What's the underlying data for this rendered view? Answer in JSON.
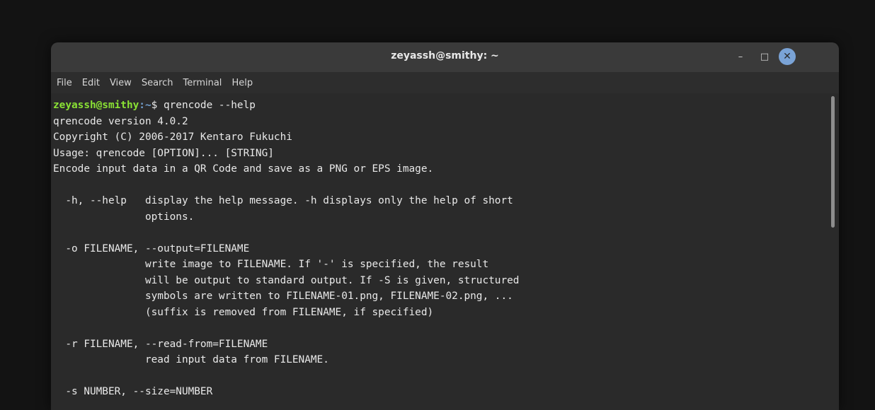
{
  "window": {
    "title": "zeyassh@smithy: ~",
    "controls": {
      "minimize": "–",
      "maximize": "□",
      "close": "✕"
    }
  },
  "menu": [
    "File",
    "Edit",
    "View",
    "Search",
    "Terminal",
    "Help"
  ],
  "terminal": {
    "prompt_user": "zeyassh@smithy",
    "prompt_path": ":~",
    "prompt_symbol": "$ ",
    "command": "qrencode --help",
    "output": [
      "qrencode version 4.0.2",
      "Copyright (C) 2006-2017 Kentaro Fukuchi",
      "Usage: qrencode [OPTION]... [STRING]",
      "Encode input data in a QR Code and save as a PNG or EPS image.",
      "",
      "  -h, --help   display the help message. -h displays only the help of short",
      "               options.",
      "",
      "  -o FILENAME, --output=FILENAME",
      "               write image to FILENAME. If '-' is specified, the result",
      "               will be output to standard output. If -S is given, structured",
      "               symbols are written to FILENAME-01.png, FILENAME-02.png, ...",
      "               (suffix is removed from FILENAME, if specified)",
      "",
      "  -r FILENAME, --read-from=FILENAME",
      "               read input data from FILENAME.",
      "",
      "  -s NUMBER, --size=NUMBER"
    ]
  },
  "colors": {
    "prompt_user": "#8ae234",
    "prompt_path": "#729fcf",
    "text": "#e9e9e9",
    "background": "#2a2a2a"
  }
}
